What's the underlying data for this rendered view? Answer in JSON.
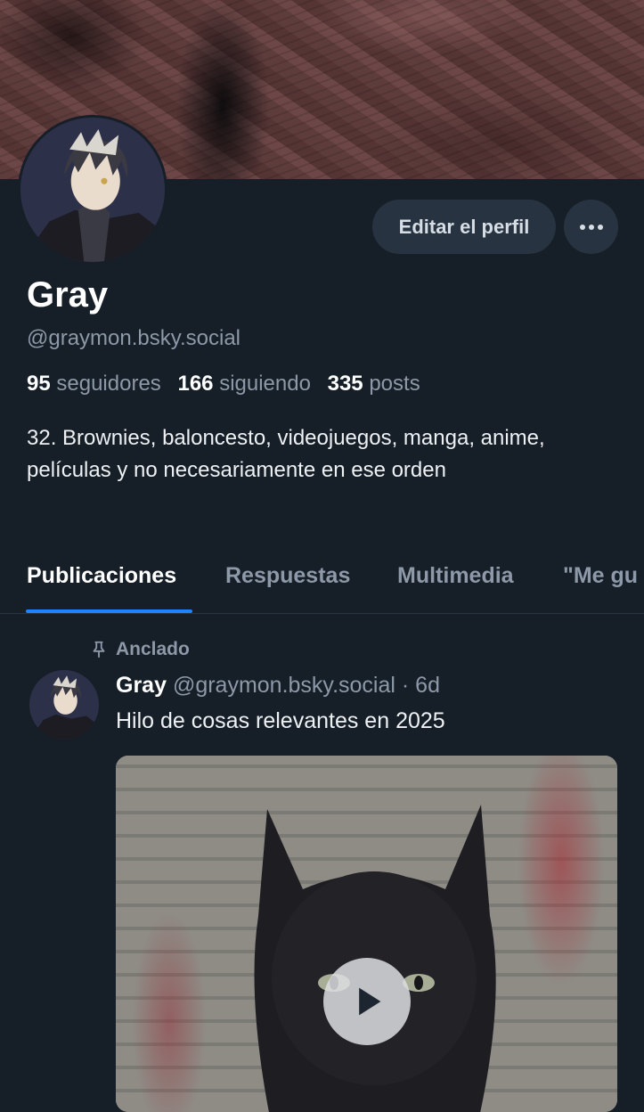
{
  "profile": {
    "name": "Gray",
    "handle": "@graymon.bsky.social",
    "followers_count": "95",
    "followers_label": "seguidores",
    "following_count": "166",
    "following_label": "siguiendo",
    "posts_count": "335",
    "posts_label": "posts",
    "bio": "32. Brownies, baloncesto, videojuegos, manga, anime, películas y no necesariamente en ese orden"
  },
  "actions": {
    "edit_profile_label": "Editar el perfil",
    "more_icon": "ellipsis-icon"
  },
  "tabs": [
    {
      "label": "Publicaciones"
    },
    {
      "label": "Respuestas"
    },
    {
      "label": "Multimedia"
    },
    {
      "label": "\"Me gu"
    }
  ],
  "pinned_post": {
    "pinned_label": "Anclado",
    "author_name": "Gray",
    "author_handle": "@graymon.bsky.social",
    "separator": "·",
    "time": "6d",
    "text": "Hilo de cosas relevantes en 2025"
  },
  "colors": {
    "background": "#161e27",
    "accent": "#1b84ff",
    "muted_text": "#8d99a8",
    "button_bg": "#273341"
  }
}
